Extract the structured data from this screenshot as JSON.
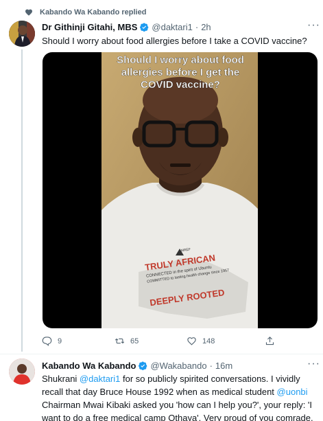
{
  "context": {
    "text": "Kabando Wa Kabando replied",
    "icon": "heart-icon"
  },
  "tweet1": {
    "name": "Dr Githinji Gitahi, MBS",
    "handle": "@daktari1",
    "time": "2h",
    "text": "Should I worry about food allergies before I take a COVID vaccine?",
    "media": {
      "caption": "Should I worry about food allergies before I get the COVID vaccine?",
      "shirt_line1": "TRULY AFRICAN",
      "shirt_line2": "CONNECTED in the spirit of Ubuntu",
      "shirt_line3": "COMMITTED to lasting health change since 1957",
      "shirt_line4": "DEEPLY ROOTED",
      "shirt_logo": "AMREF"
    },
    "actions": {
      "replies": "9",
      "retweets": "65",
      "likes": "148"
    }
  },
  "tweet2": {
    "name": "Kabando Wa Kabando",
    "handle": "@Wakabando",
    "time": "16m",
    "text_parts": {
      "p1": "Shukrani ",
      "m1": "@daktari1",
      "p2": " for so publicly spirited conversations. I vividly recall that day Bruce House 1992 when as medical student ",
      "m2": "@uonbi",
      "p3": " Chairman Mwai Kibaki asked you 'how can I help you?', your reply: 'I want to do a free medical camp Othaya'. Very proud of you comrade. So helpful!"
    }
  },
  "colors": {
    "accent": "#1d9bf0",
    "muted": "#536471",
    "text": "#0f1419"
  }
}
